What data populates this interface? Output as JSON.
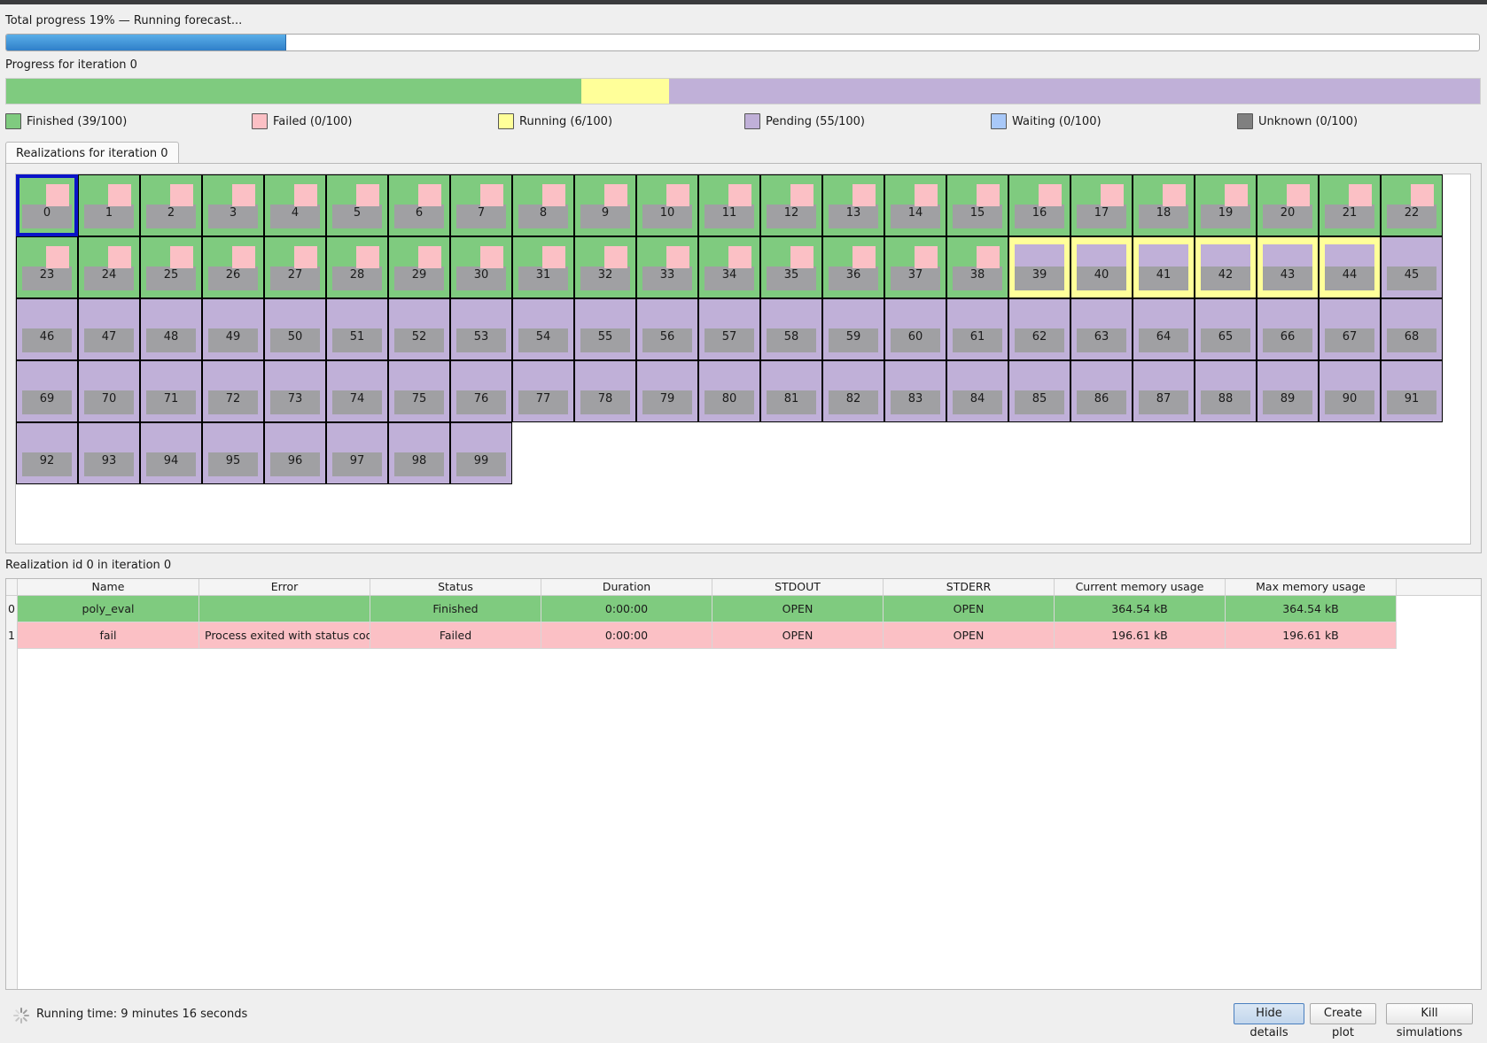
{
  "total_progress": {
    "label": "Total progress 19% — Running forecast...",
    "fraction": 0.19
  },
  "iteration": {
    "label": "Progress for iteration 0",
    "segments": [
      {
        "name": "Finished",
        "count": 39,
        "color": "#7fcb7f"
      },
      {
        "name": "Running",
        "count": 6,
        "color": "#ffff99"
      },
      {
        "name": "Pending",
        "count": 55,
        "color": "#c0b0d8"
      }
    ]
  },
  "legend": [
    {
      "label": "Finished (39/100)",
      "color": "#7fcb7f"
    },
    {
      "label": "Failed (0/100)",
      "color": "#fbc0c5"
    },
    {
      "label": "Running (6/100)",
      "color": "#ffff99"
    },
    {
      "label": "Pending (55/100)",
      "color": "#c0b0d8"
    },
    {
      "label": "Waiting (0/100)",
      "color": "#a8c8f8"
    },
    {
      "label": "Unknown (0/100)",
      "color": "#808080"
    }
  ],
  "tab_label": "Realizations for iteration 0",
  "realizations": {
    "total": 100,
    "finished": 39,
    "running": 6,
    "selected": 0,
    "colors": {
      "finished": "#7fcb7f",
      "running": "#ffff99",
      "pending": "#c0b0d8",
      "failed_job": "#fbc0c5",
      "job_gray": "#a0a0a3"
    }
  },
  "detail_label": "Realization id 0 in iteration 0",
  "table": {
    "headers": [
      "Name",
      "Error",
      "Status",
      "Duration",
      "STDOUT",
      "STDERR",
      "Current memory usage",
      "Max memory usage"
    ],
    "rows": [
      {
        "index": "0",
        "color": "#7fcb7f",
        "cells": [
          "poly_eval",
          "",
          "Finished",
          "0:00:00",
          "OPEN",
          "OPEN",
          "364.54 kB",
          "364.54 kB"
        ]
      },
      {
        "index": "1",
        "color": "#fbc0c5",
        "cells": [
          "fail",
          "Process exited with status cod...",
          "Failed",
          "0:00:00",
          "OPEN",
          "OPEN",
          "196.61 kB",
          "196.61 kB"
        ]
      }
    ]
  },
  "footer": {
    "running_time": "Running time: 9 minutes 16 seconds",
    "hide_details": "Hide details",
    "create_plot": "Create plot",
    "kill_simulations": "Kill simulations"
  }
}
